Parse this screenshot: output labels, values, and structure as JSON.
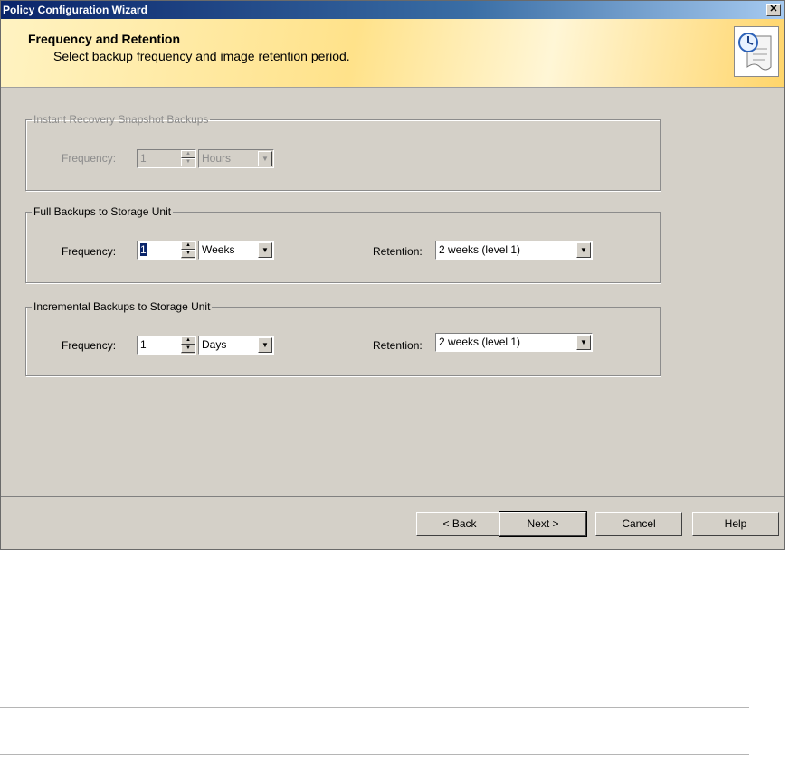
{
  "window": {
    "title": "Policy Configuration Wizard",
    "close_glyph": "✕"
  },
  "header": {
    "title": "Frequency and Retention",
    "subtitle": "Select backup frequency and image retention period."
  },
  "groups": {
    "instant": {
      "legend": "Instant Recovery Snapshot Backups",
      "frequency_label": "Frequency:",
      "frequency_value": "1",
      "unit": "Hours"
    },
    "full": {
      "legend": "Full Backups to Storage Unit",
      "frequency_label": "Frequency:",
      "frequency_value": "1",
      "unit": "Weeks",
      "retention_label": "Retention:",
      "retention_value": "2 weeks (level 1)"
    },
    "incremental": {
      "legend": "Incremental Backups to Storage Unit",
      "frequency_label": "Frequency:",
      "frequency_value": "1",
      "unit": "Days",
      "retention_label": "Retention:",
      "retention_value": "2 weeks (level 1)"
    }
  },
  "buttons": {
    "back": "< Back",
    "next": "Next >",
    "cancel": "Cancel",
    "help": "Help"
  },
  "icons": {
    "header": "policy-clock-document-icon",
    "spin_up": "▲",
    "spin_down": "▼",
    "dropdown": "▼"
  }
}
